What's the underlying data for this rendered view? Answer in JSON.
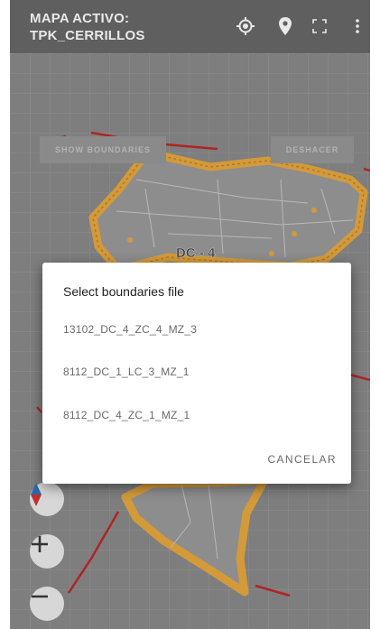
{
  "appbar": {
    "title_line1": "MAPA ACTIVO:",
    "title_line2": "TPK_CERRILLOS",
    "actions": [
      "my-location-icon",
      "place-marker-icon",
      "fullscreen-icon",
      "more-vert-icon"
    ]
  },
  "map": {
    "show_boundaries_label": "SHOW BOUNDARIES",
    "undo_label": "DESHACER",
    "district_label": "DC - 4",
    "controls": [
      "compass-icon",
      "zoom-in-icon",
      "zoom-out-icon"
    ]
  },
  "dialog": {
    "title": "Select boundaries file",
    "options": [
      "13102_DC_4_ZC_4_MZ_3",
      "8112_DC_1_LC_3_MZ_1",
      "8112_DC_4_ZC_1_MZ_1"
    ],
    "cancel_label": "CANCELAR"
  },
  "colors": {
    "appbar": "#5f5f5f",
    "map_background": "#7e7e7e",
    "boundary_orange": "#d39a3a",
    "route_red": "#b02424",
    "dialog_background": "#ffffff"
  }
}
